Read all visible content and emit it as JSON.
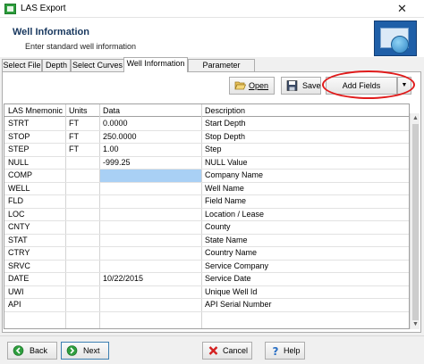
{
  "window": {
    "title": "LAS Export",
    "close_glyph": "✕",
    "app_icon": "las-export-app-icon"
  },
  "header": {
    "title": "Well Information",
    "subtitle": "Enter standard well information",
    "logo_icon": "globe-window-icon"
  },
  "tabs": [
    {
      "label": "Select File",
      "active": false
    },
    {
      "label": "Depth",
      "active": false
    },
    {
      "label": "Select Curves",
      "active": false
    },
    {
      "label": "Well Information",
      "active": true
    },
    {
      "label": "Parameter Section",
      "active": false
    }
  ],
  "toolbar": {
    "open_label": "Open",
    "save_label": "Save",
    "add_fields_label": "Add Fields",
    "dropdown_glyph": "▼"
  },
  "table": {
    "columns": [
      "LAS Mnemonic",
      "Units",
      "Data",
      "Description"
    ],
    "rows": [
      [
        "STRT",
        "FT",
        "0.0000",
        "Start Depth"
      ],
      [
        "STOP",
        "FT",
        "250.0000",
        "Stop Depth"
      ],
      [
        "STEP",
        "FT",
        "1.00",
        "Step"
      ],
      [
        "NULL",
        "",
        "-999.25",
        "NULL Value"
      ],
      [
        "COMP",
        "",
        "",
        "Company Name"
      ],
      [
        "WELL",
        "",
        "",
        "Well Name"
      ],
      [
        "FLD",
        "",
        "",
        "Field Name"
      ],
      [
        "LOC",
        "",
        "",
        "Location / Lease"
      ],
      [
        "CNTY",
        "",
        "",
        "County"
      ],
      [
        "STAT",
        "",
        "",
        "State Name"
      ],
      [
        "CTRY",
        "",
        "",
        "Country Name"
      ],
      [
        "SRVC",
        "",
        "",
        "Service Company"
      ],
      [
        "DATE",
        "",
        "10/22/2015",
        "Service Date"
      ],
      [
        "UWI",
        "",
        "",
        "Unique Well Id"
      ],
      [
        "API",
        "",
        "",
        "API Serial Number"
      ]
    ],
    "selected_row": 4,
    "selected_col": 2
  },
  "footer": {
    "back_label": "Back",
    "next_label": "Next",
    "cancel_label": "Cancel",
    "help_label": "Help"
  },
  "colors": {
    "header_title": "#17375e",
    "selection": "#a9d0f5",
    "highlight_ring": "#e01b1b",
    "back_icon": "#2e9e3e",
    "next_icon": "#2e9e3e",
    "cancel_icon": "#d42020",
    "help_icon": "#2a6fc4"
  }
}
